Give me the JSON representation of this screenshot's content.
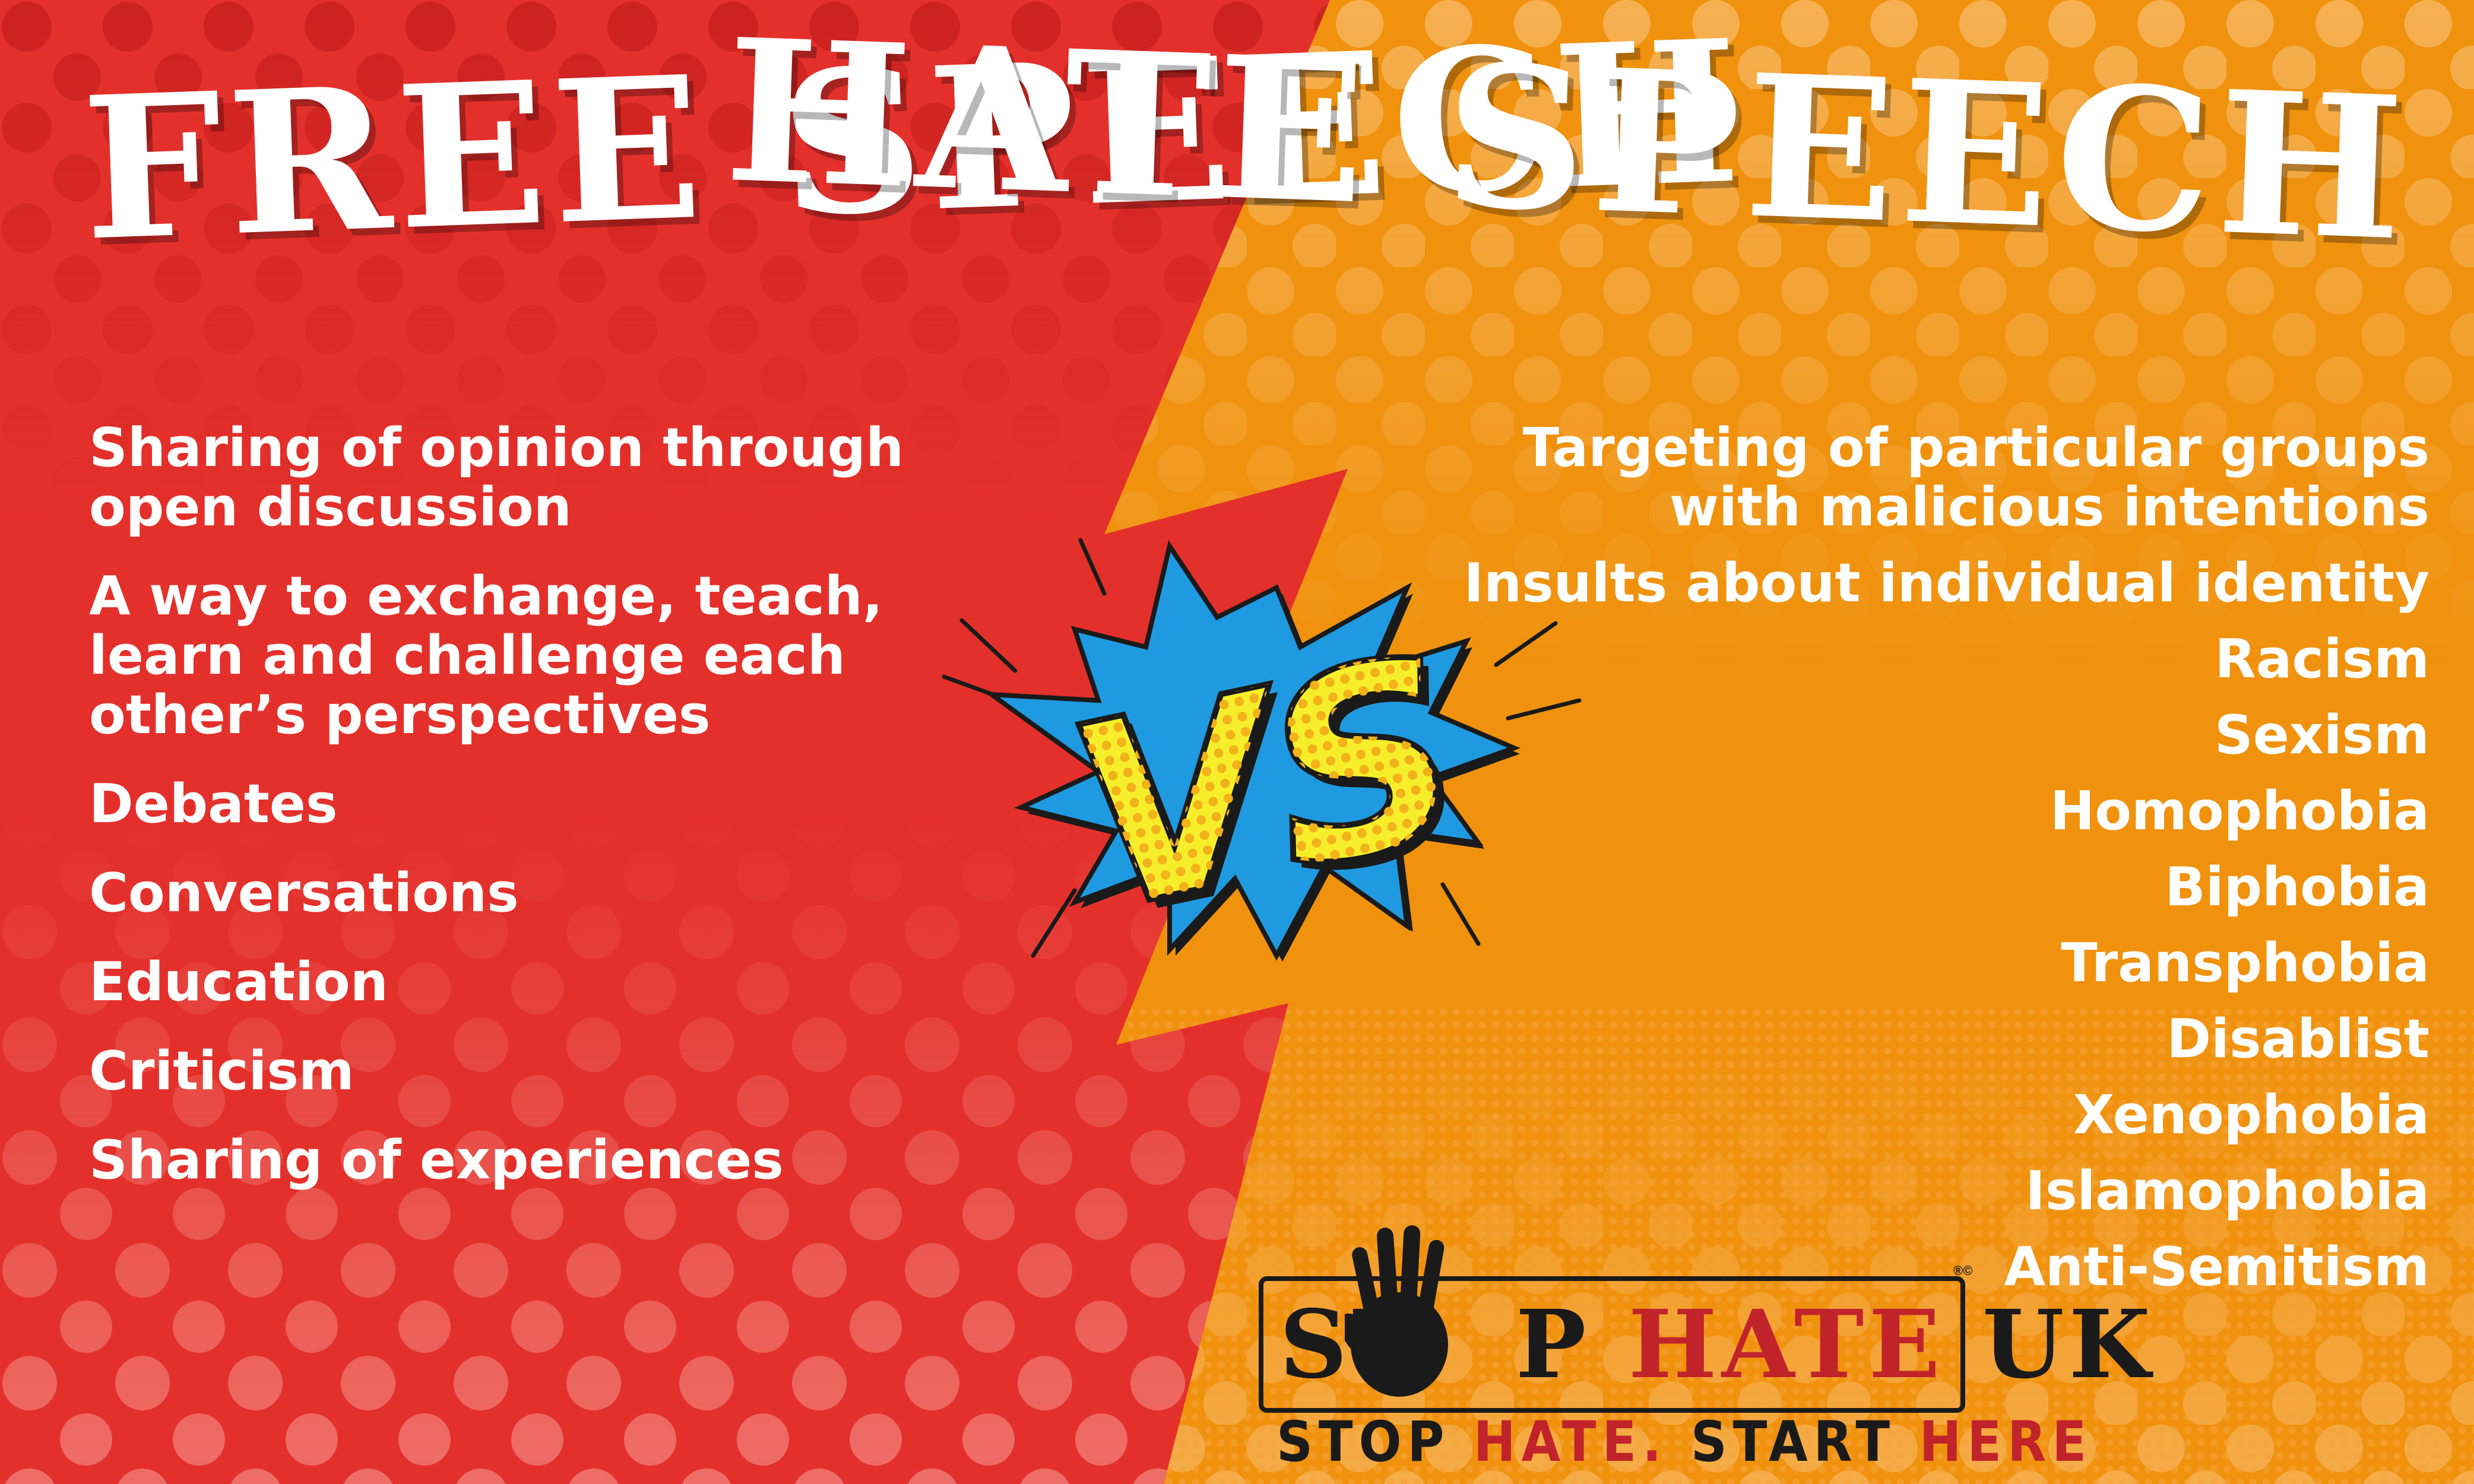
{
  "colors": {
    "left_bg": "#e4302b",
    "right_bg": "#f0920e",
    "vs_burst": "#1f9ae0",
    "vs_letters": "#f7ee2b",
    "text": "#ffffff",
    "logo_red": "#c1232a",
    "logo_dark": "#1a1a1a"
  },
  "left": {
    "title": "FREE SPEECH",
    "items": [
      "Sharing of opinion through open discussion",
      "A way to exchange, teach, learn and challenge each other’s perspectives",
      "Debates",
      "Conversations",
      "Education",
      "Criticism",
      "Sharing of experiences"
    ]
  },
  "right": {
    "title": "HATE SPEECH",
    "items": [
      "Targeting of particular groups with malicious intentions",
      "Insults about individual identity",
      "Racism",
      "Sexism",
      "Homophobia",
      "Biphobia",
      "Transphobia",
      "Disablist",
      "Xenophobia",
      "Islamophobia",
      "Anti-Semitism"
    ]
  },
  "vs": {
    "text": "VS"
  },
  "logo": {
    "part_stop_1": "ST",
    "part_stop_2": "P",
    "part_hate": "HATE",
    "part_uk": "UK",
    "registered": "®©",
    "tagline_1": "STOP",
    "tagline_2": "HATE.",
    "tagline_3": "START",
    "tagline_4": "HERE",
    "hand_icon": "hand-icon"
  }
}
